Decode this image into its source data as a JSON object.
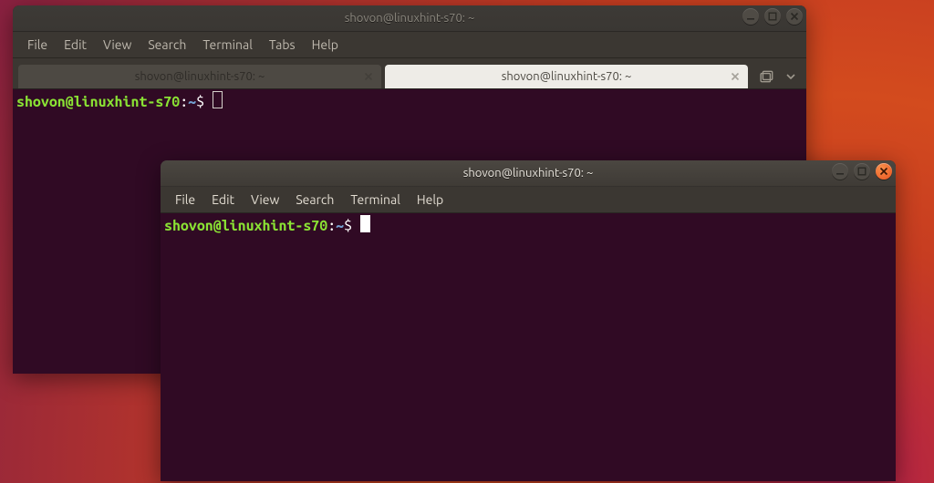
{
  "window1": {
    "title": "shovon@linuxhint-s70: ~",
    "menu": {
      "file": "File",
      "edit": "Edit",
      "view": "View",
      "search": "Search",
      "terminal": "Terminal",
      "tabs": "Tabs",
      "help": "Help"
    },
    "tabs": [
      {
        "label": "shovon@linuxhint-s70: ~",
        "active": true
      },
      {
        "label": "shovon@linuxhint-s70: ~",
        "active": false
      }
    ],
    "prompt": {
      "userhost": "shovon@linuxhint-s70",
      "colon": ":",
      "path": "~",
      "dollar": "$"
    }
  },
  "window2": {
    "title": "shovon@linuxhint-s70: ~",
    "menu": {
      "file": "File",
      "edit": "Edit",
      "view": "View",
      "search": "Search",
      "terminal": "Terminal",
      "help": "Help"
    },
    "prompt": {
      "userhost": "shovon@linuxhint-s70",
      "colon": ":",
      "path": "~",
      "dollar": "$"
    }
  }
}
